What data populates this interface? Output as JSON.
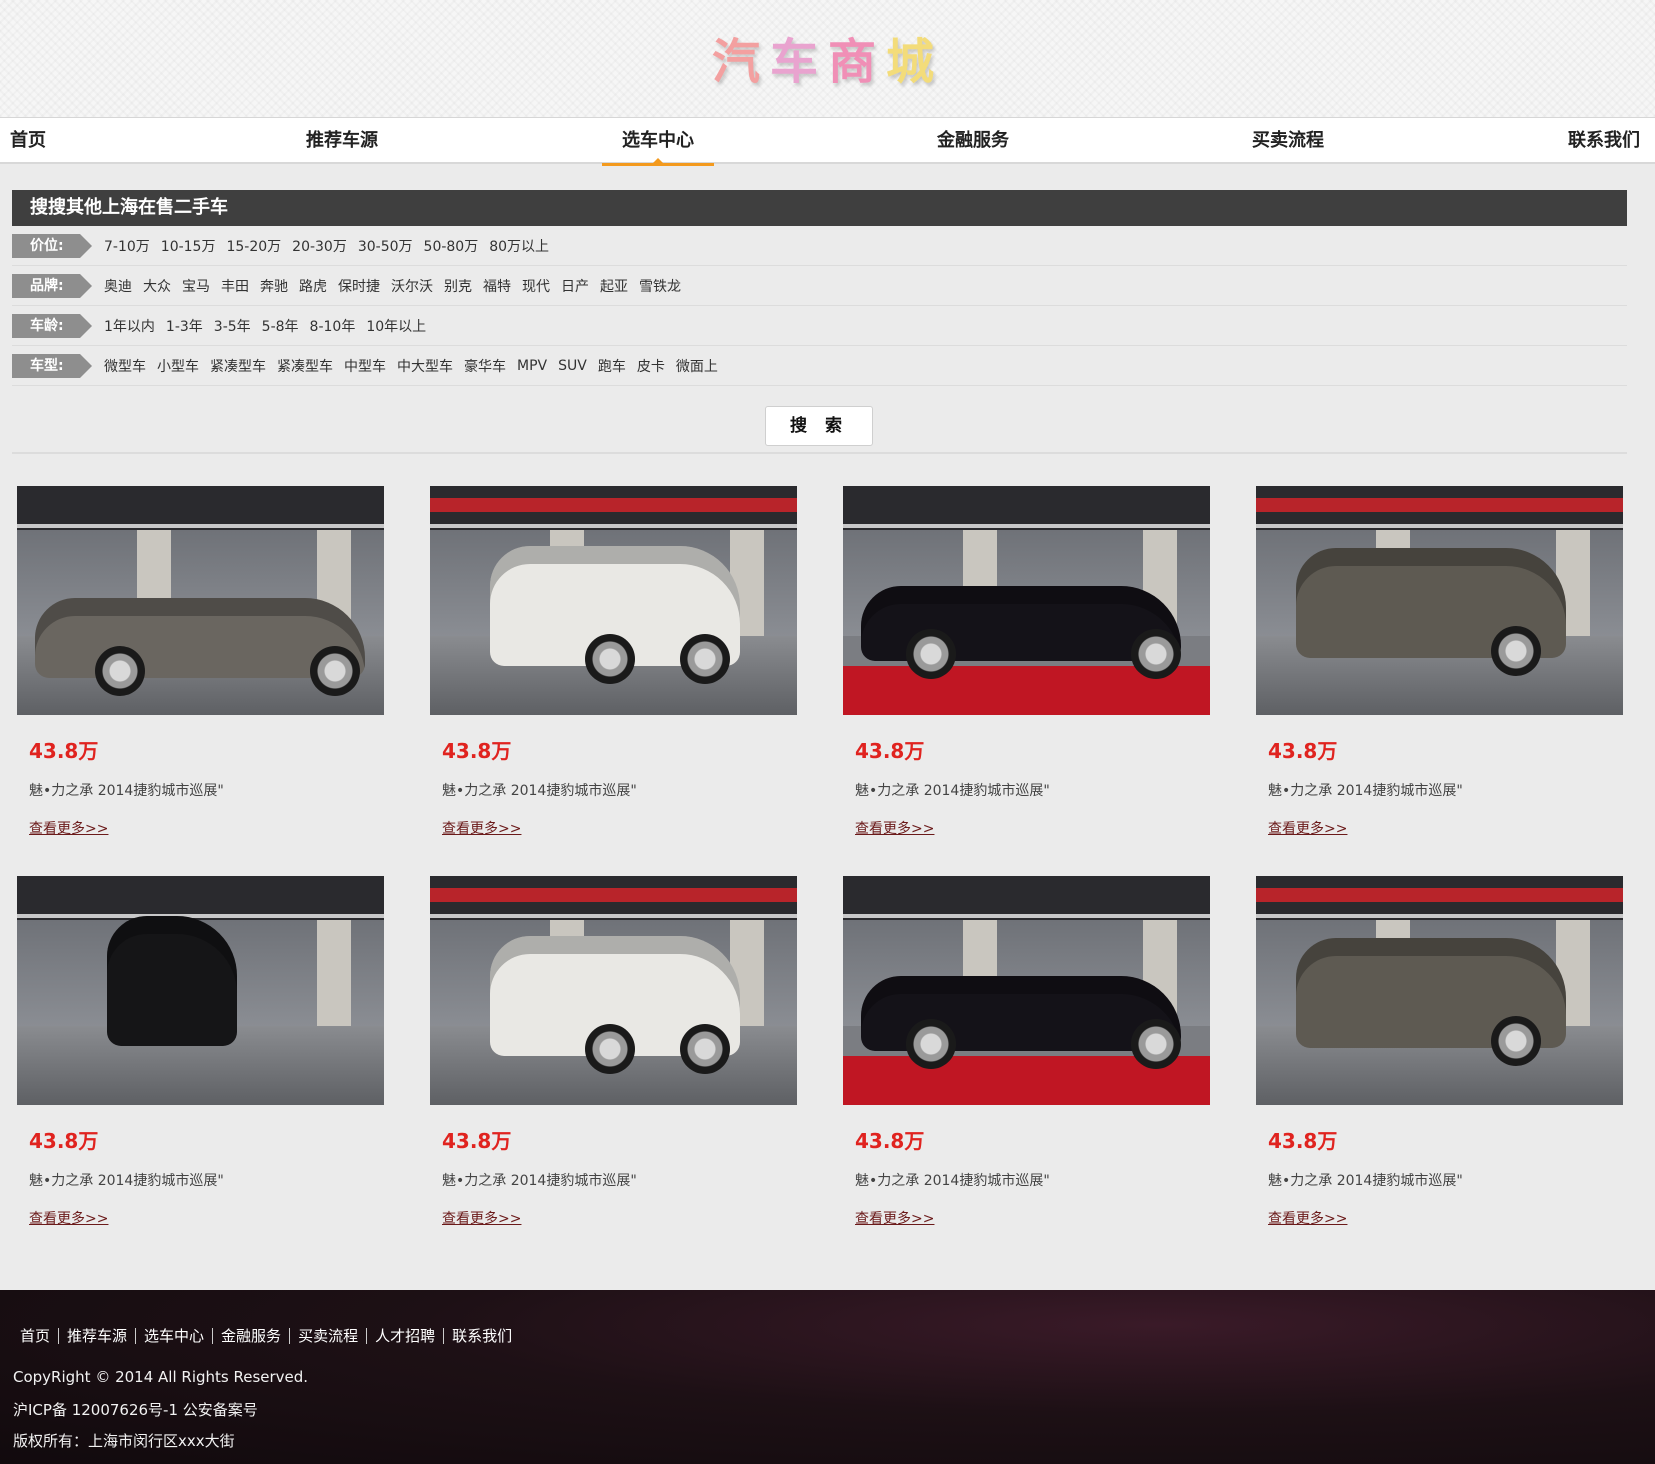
{
  "logo": {
    "chars": [
      "汽",
      "车",
      "商",
      "城"
    ]
  },
  "nav": {
    "items": [
      "首页",
      "推荐车源",
      "选车中心",
      "金融服务",
      "买卖流程",
      "联系我们"
    ],
    "active": "选车中心"
  },
  "filter": {
    "title": "搜搜其他上海在售二手车",
    "rows": [
      {
        "label": "价位:",
        "options": [
          "7-10万",
          "10-15万",
          "15-20万",
          "20-30万",
          "30-50万",
          "50-80万",
          "80万以上"
        ]
      },
      {
        "label": "品牌:",
        "options": [
          "奥迪",
          "大众",
          "宝马",
          "丰田",
          "奔驰",
          "路虎",
          "保时捷",
          "沃尔沃",
          "别克",
          "福特",
          "现代",
          "日产",
          "起亚",
          "雪铁龙"
        ]
      },
      {
        "label": "车龄:",
        "options": [
          "1年以内",
          "1-3年",
          "3-5年",
          "5-8年",
          "8-10年",
          "10年以上"
        ]
      },
      {
        "label": "车型:",
        "options": [
          "微型车",
          "小型车",
          "紧凑型车",
          "紧凑型车",
          "中型车",
          "中大型车",
          "豪华车",
          "MPV",
          "SUV",
          "跑车",
          "皮卡",
          "微面上"
        ]
      }
    ],
    "search_label": "搜 索"
  },
  "cars": [
    {
      "price": "43.8万",
      "desc": "魅•力之承 2014捷豹城市巡展\"",
      "more": "查看更多>>",
      "photo": "grey-sedan-icon"
    },
    {
      "price": "43.8万",
      "desc": "魅•力之承 2014捷豹城市巡展\"",
      "more": "查看更多>>",
      "photo": "white-suv-icon"
    },
    {
      "price": "43.8万",
      "desc": "魅•力之承 2014捷豹城市巡展\"",
      "more": "查看更多>>",
      "photo": "black-convertible-icon"
    },
    {
      "price": "43.8万",
      "desc": "魅•力之承 2014捷豹城市巡展\"",
      "more": "查看更多>>",
      "photo": "grey-sedan-front-icon"
    },
    {
      "price": "43.8万",
      "desc": "魅•力之承 2014捷豹城市巡展\"",
      "more": "查看更多>>",
      "photo": "black-suv-front-icon"
    },
    {
      "price": "43.8万",
      "desc": "魅•力之承 2014捷豹城市巡展\"",
      "more": "查看更多>>",
      "photo": "white-suv-icon"
    },
    {
      "price": "43.8万",
      "desc": "魅•力之承 2014捷豹城市巡展\"",
      "more": "查看更多>>",
      "photo": "black-convertible-icon"
    },
    {
      "price": "43.8万",
      "desc": "魅•力之承 2014捷豹城市巡展\"",
      "more": "查看更多>>",
      "photo": "grey-sedan-front-icon"
    }
  ],
  "footer": {
    "links": [
      "首页",
      "推荐车源",
      "选车中心",
      "金融服务",
      "买卖流程",
      "人才招聘",
      "联系我们"
    ],
    "copyright": "CopyRight © 2014 All Rights Reserved.",
    "icp": "沪ICP备 12007626号-1 公安备案号",
    "owner": "版权所有：上海市闵行区xxx大街"
  },
  "colors": {
    "accent": "#f39a1e",
    "price": "#e0231f",
    "title_bar": "#3f3f3f"
  }
}
